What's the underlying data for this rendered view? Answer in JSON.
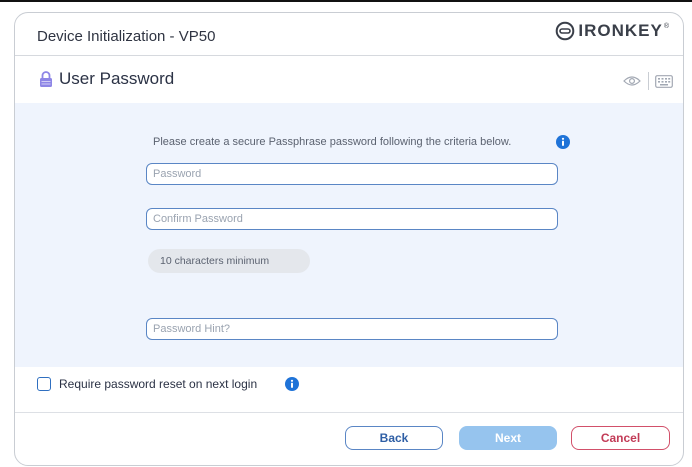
{
  "window": {
    "title": "Device Initialization - VP50",
    "brand": "IRONKEY",
    "brand_mark": "®"
  },
  "section": {
    "title": "User Password",
    "icons": [
      "lock-icon",
      "eye-icon",
      "keyboard-icon"
    ]
  },
  "form": {
    "instruction": "Please create a secure Passphrase password following the criteria below.",
    "password_placeholder": "Password",
    "confirm_placeholder": "Confirm Password",
    "criteria": "10 characters minimum",
    "hint_placeholder": "Password Hint?"
  },
  "options": {
    "reset_label": "Require password reset on next login",
    "reset_checked": false
  },
  "buttons": {
    "back": "Back",
    "next": "Next",
    "cancel": "Cancel"
  },
  "colors": {
    "accent": "#1f73d8",
    "panel_bg": "#eff4fd",
    "field_border": "#5a86c5",
    "next_disabled": "#96c4ee",
    "cancel": "#c23b57"
  }
}
